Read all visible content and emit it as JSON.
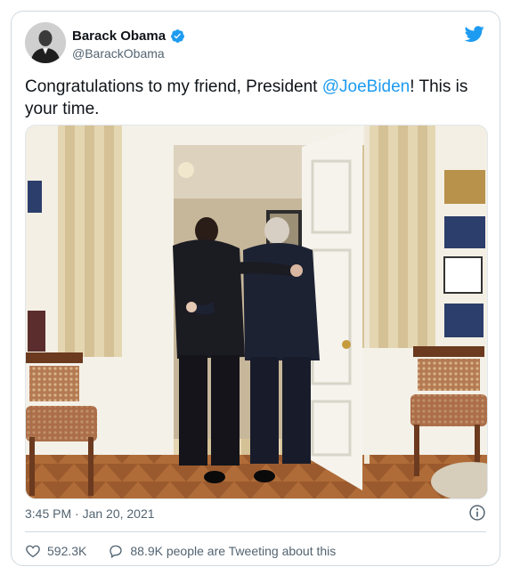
{
  "author": {
    "name": "Barack Obama",
    "handle": "@BarackObama",
    "verified": true
  },
  "tweet": {
    "text_before": "Congratulations to my friend, President ",
    "mention": "@JoeBiden",
    "text_after": "! This is your time.",
    "timestamp": "3:45 PM · Jan 20, 2021"
  },
  "stats": {
    "likes": "592.3K",
    "tweeting": "88.9K people are Tweeting about this"
  },
  "icons": {
    "platform": "twitter-bird-icon",
    "verified": "verified-badge-icon",
    "info": "info-icon",
    "like": "heart-icon",
    "reply": "speech-bubble-icon"
  },
  "colors": {
    "accent": "#1d9bf0",
    "text": "#0f1419",
    "muted": "#536471",
    "border": "#cfd9de"
  }
}
